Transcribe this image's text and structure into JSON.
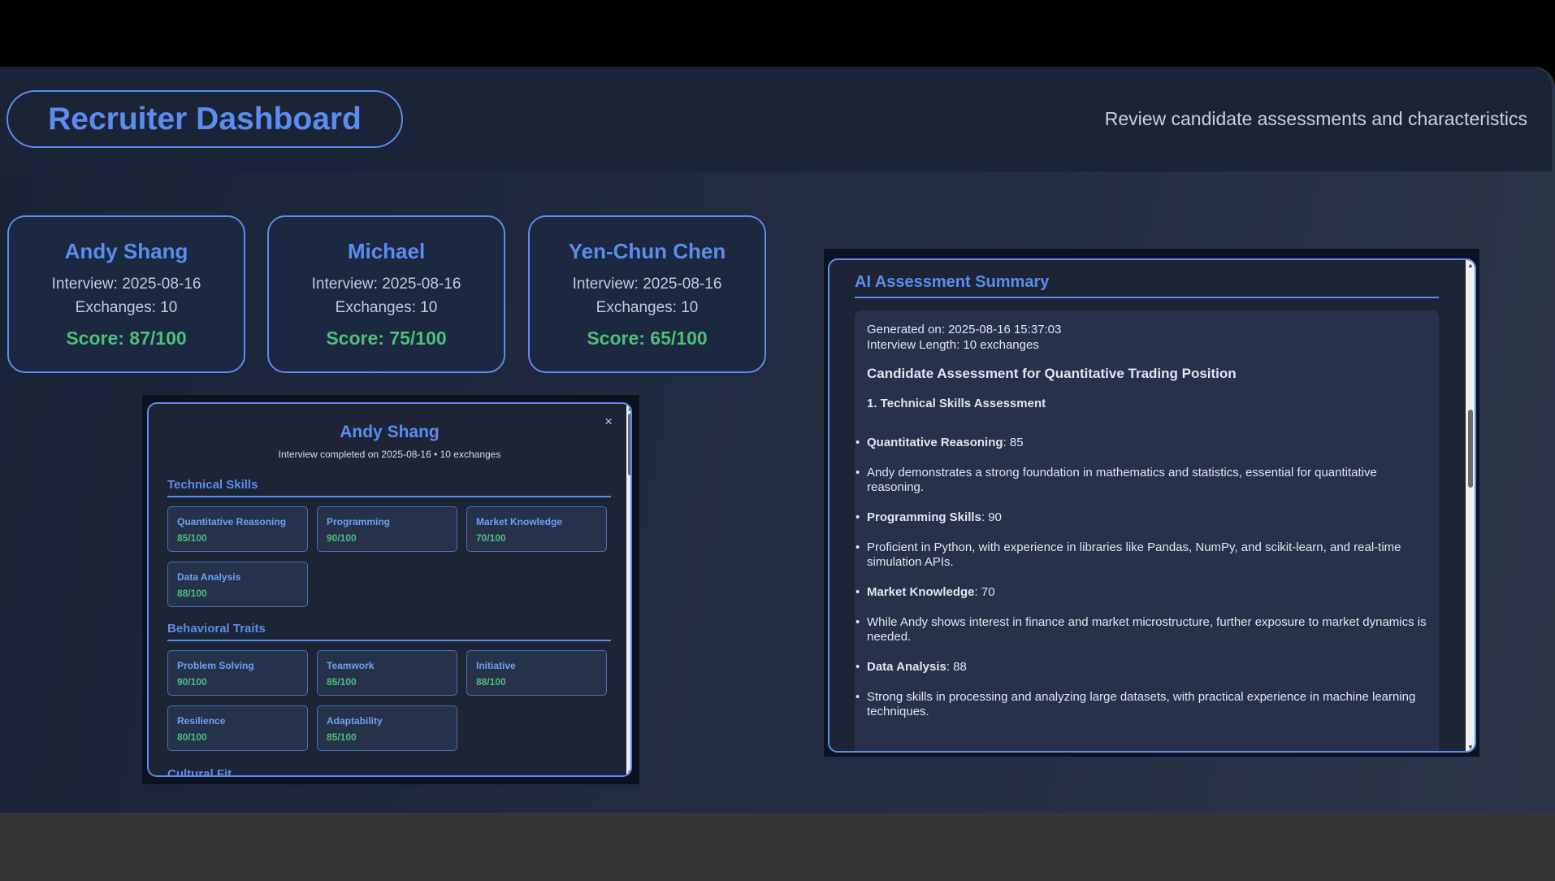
{
  "header": {
    "title": "Recruiter Dashboard",
    "subtitle": "Review candidate assessments and characteristics"
  },
  "candidates": [
    {
      "name": "Andy Shang",
      "interview": "Interview: 2025-08-16",
      "exchanges": "Exchanges: 10",
      "score": "Score: 87/100"
    },
    {
      "name": "Michael",
      "interview": "Interview: 2025-08-16",
      "exchanges": "Exchanges: 10",
      "score": "Score: 75/100"
    },
    {
      "name": "Yen-Chun Chen",
      "interview": "Interview: 2025-08-16",
      "exchanges": "Exchanges: 10",
      "score": "Score: 65/100"
    }
  ],
  "detail_modal": {
    "close": "×",
    "name": "Andy Shang",
    "subtitle": "Interview completed on 2025-08-16 • 10 exchanges",
    "technical_title": "Technical Skills",
    "technical": [
      {
        "label": "Quantitative Reasoning",
        "value": "85/100"
      },
      {
        "label": "Programming",
        "value": "90/100"
      },
      {
        "label": "Market Knowledge",
        "value": "70/100"
      },
      {
        "label": "Data Analysis",
        "value": "88/100"
      }
    ],
    "behavioral_title": "Behavioral Traits",
    "behavioral": [
      {
        "label": "Problem Solving",
        "value": "90/100"
      },
      {
        "label": "Teamwork",
        "value": "85/100"
      },
      {
        "label": "Initiative",
        "value": "88/100"
      },
      {
        "label": "Resilience",
        "value": "80/100"
      },
      {
        "label": "Adaptability",
        "value": "85/100"
      }
    ],
    "cultural_title": "Cultural Fit"
  },
  "summary_modal": {
    "title": "AI Assessment Summary",
    "generated": "Generated on: 2025-08-16 15:37:03",
    "length": "Interview Length: 10 exchanges",
    "heading": "Candidate Assessment for Quantitative Trading Position",
    "section": "1. Technical Skills Assessment",
    "items": [
      {
        "bold": "Quantitative Reasoning",
        "text": ": 85"
      },
      {
        "bold": "",
        "text": "Andy demonstrates a strong foundation in mathematics and statistics, essential for quantitative reasoning."
      },
      {
        "bold": "Programming Skills",
        "text": ": 90"
      },
      {
        "bold": "",
        "text": "Proficient in Python, with experience in libraries like Pandas, NumPy, and scikit-learn, and real-time simulation APIs."
      },
      {
        "bold": "Market Knowledge",
        "text": ": 70"
      },
      {
        "bold": "",
        "text": "While Andy shows interest in finance and market microstructure, further exposure to market dynamics is needed."
      },
      {
        "bold": "Data Analysis",
        "text": ": 88"
      },
      {
        "bold": "",
        "text": "Strong skills in processing and analyzing large datasets, with practical experience in machine learning techniques."
      }
    ]
  }
}
